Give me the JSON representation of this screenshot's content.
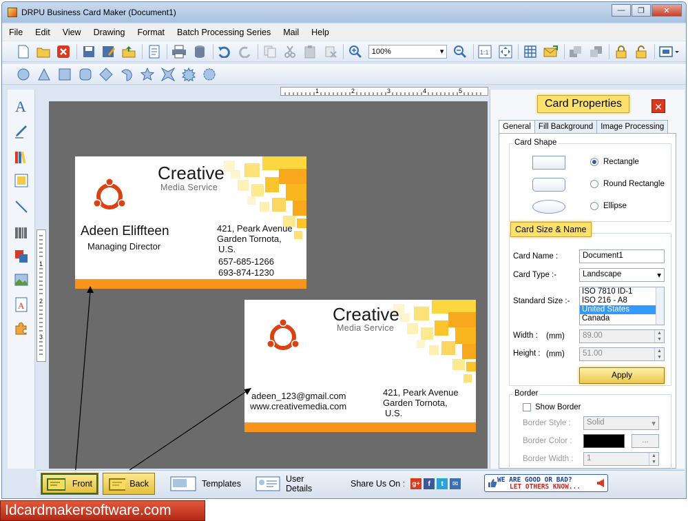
{
  "window": {
    "title": "DRPU Business Card Maker (Document1)"
  },
  "menu": [
    "File",
    "Edit",
    "View",
    "Drawing",
    "Format",
    "Batch Processing Series",
    "Mail",
    "Help"
  ],
  "toolbar": {
    "zoom_value": "100%"
  },
  "rulers": {
    "h_ticks": [
      "1",
      "2",
      "3",
      "4",
      "5"
    ],
    "v_ticks": [
      "1",
      "2",
      "3"
    ]
  },
  "cards": {
    "front": {
      "company": "Creative",
      "subtitle": "Media Service",
      "name": "Adeen Eliffteen",
      "role": "Managing Director",
      "addr1": "421, Peark Avenue",
      "addr2": "Garden Tornota,",
      "addr3": "U.S.",
      "phone1": "657-685-1266",
      "phone2": "693-874-1230"
    },
    "back": {
      "company": "Creative",
      "subtitle": "Media Service",
      "email": "adeen_123@gmail.com",
      "web": "www.creativemedia.com",
      "addr1": "421, Peark Avenue",
      "addr2": "Garden Tornota,",
      "addr3": "U.S."
    }
  },
  "panel": {
    "title": "Card Properties",
    "close": "✕",
    "tabs": [
      "General",
      "Fill Background",
      "Image Processing"
    ],
    "card_shape": {
      "label": "Card Shape",
      "options": [
        "Rectangle",
        "Round Rectangle",
        "Ellipse"
      ],
      "selected": "Rectangle"
    },
    "size_name": {
      "label": "Card Size & Name",
      "card_name_label": "Card Name :",
      "card_name_value": "Document1",
      "card_type_label": "Card Type :-",
      "card_type_value": "Landscape",
      "standard_size_label": "Standard Size :-",
      "standard_sizes": [
        "ISO 7810 ID-1",
        "ISO 216 - A8",
        "United States",
        "Canada"
      ],
      "standard_size_selected": "United States",
      "width_label": "Width :",
      "height_label": "Height :",
      "unit": "(mm)",
      "width_value": "89.00",
      "height_value": "51.00",
      "apply": "Apply"
    },
    "border": {
      "label": "Border",
      "show_border": "Show Border",
      "style_label": "Border Style :",
      "style_value": "Solid",
      "color_label": "Border Color :",
      "color_value": "#000000",
      "color_button": "...",
      "width_label": "Border Width :",
      "width_value": "1"
    }
  },
  "bottom": {
    "front": "Front",
    "back": "Back",
    "templates": "Templates",
    "user_details": "User Details",
    "share": "Share Us On :",
    "feedback_line1": "WE ARE GOOD OR BAD?",
    "feedback_line2": "LET OTHERS KNOW..."
  },
  "brand": "Idcardmakersoftware.com",
  "colors": {
    "accent_orange": "#f7941d",
    "highlight_yellow": "#fbe16b",
    "logo_red": "#d94314"
  }
}
